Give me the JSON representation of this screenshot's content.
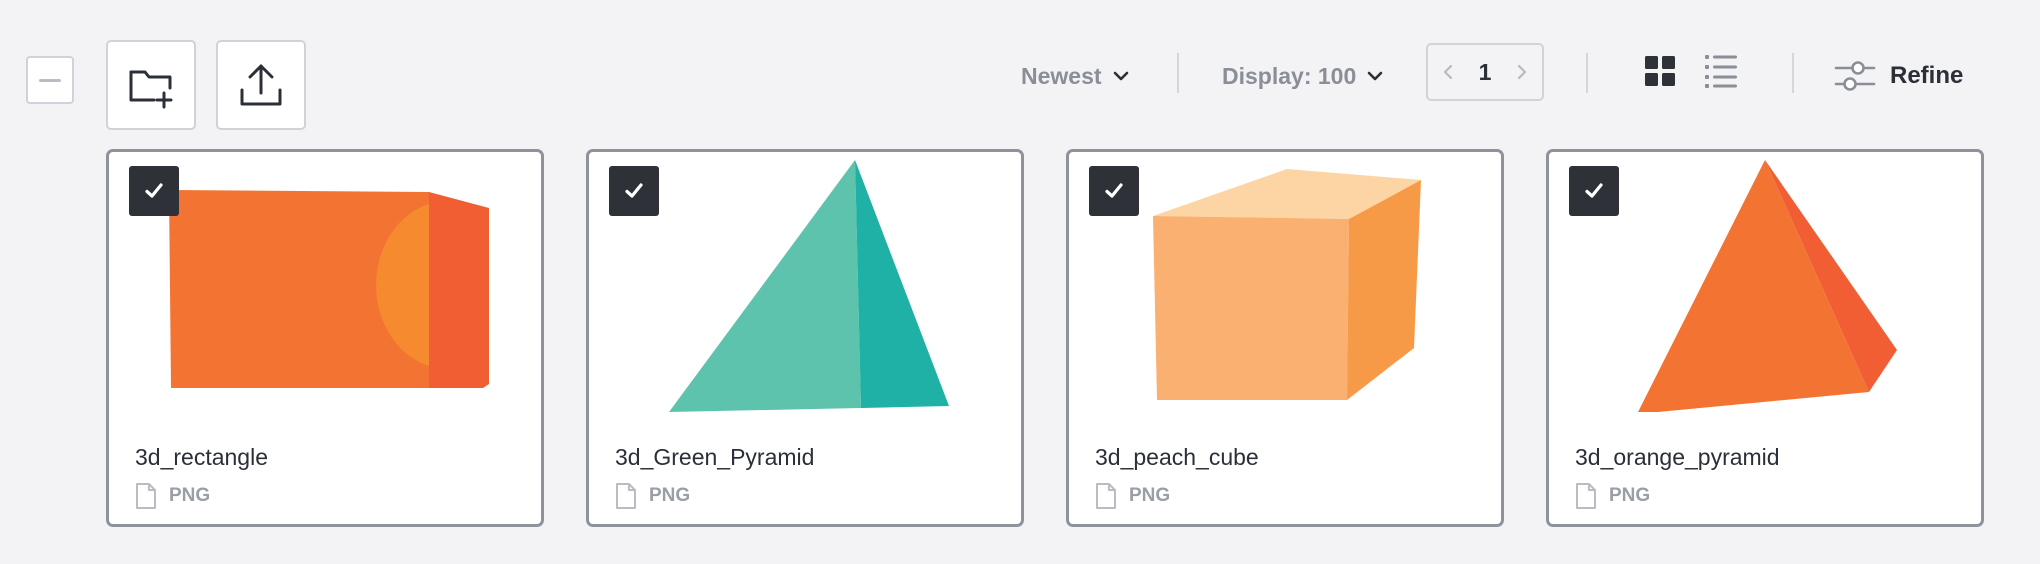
{
  "toolbar": {
    "sort_label": "Newest",
    "display_label": "Display: 100",
    "page_number": "1",
    "refine_label": "Refine"
  },
  "icons": {
    "deselect": "minus-icon",
    "new_folder": "folder-plus-icon",
    "upload": "upload-icon",
    "grid_view": "grid-icon",
    "list_view": "list-icon",
    "refine": "sliders-icon"
  },
  "assets": [
    {
      "name": "3d_rectangle",
      "type": "PNG",
      "selected": true
    },
    {
      "name": "3d_Green_Pyramid",
      "type": "PNG",
      "selected": true
    },
    {
      "name": "3d_peach_cube",
      "type": "PNG",
      "selected": true
    },
    {
      "name": "3d_orange_pyramid",
      "type": "PNG",
      "selected": true
    }
  ],
  "colors": {
    "background": "#f3f3f5",
    "selected_check": "#2e3138",
    "orange": "#f37432",
    "teal": "#5ec3ad",
    "peach": "#f9b071"
  }
}
